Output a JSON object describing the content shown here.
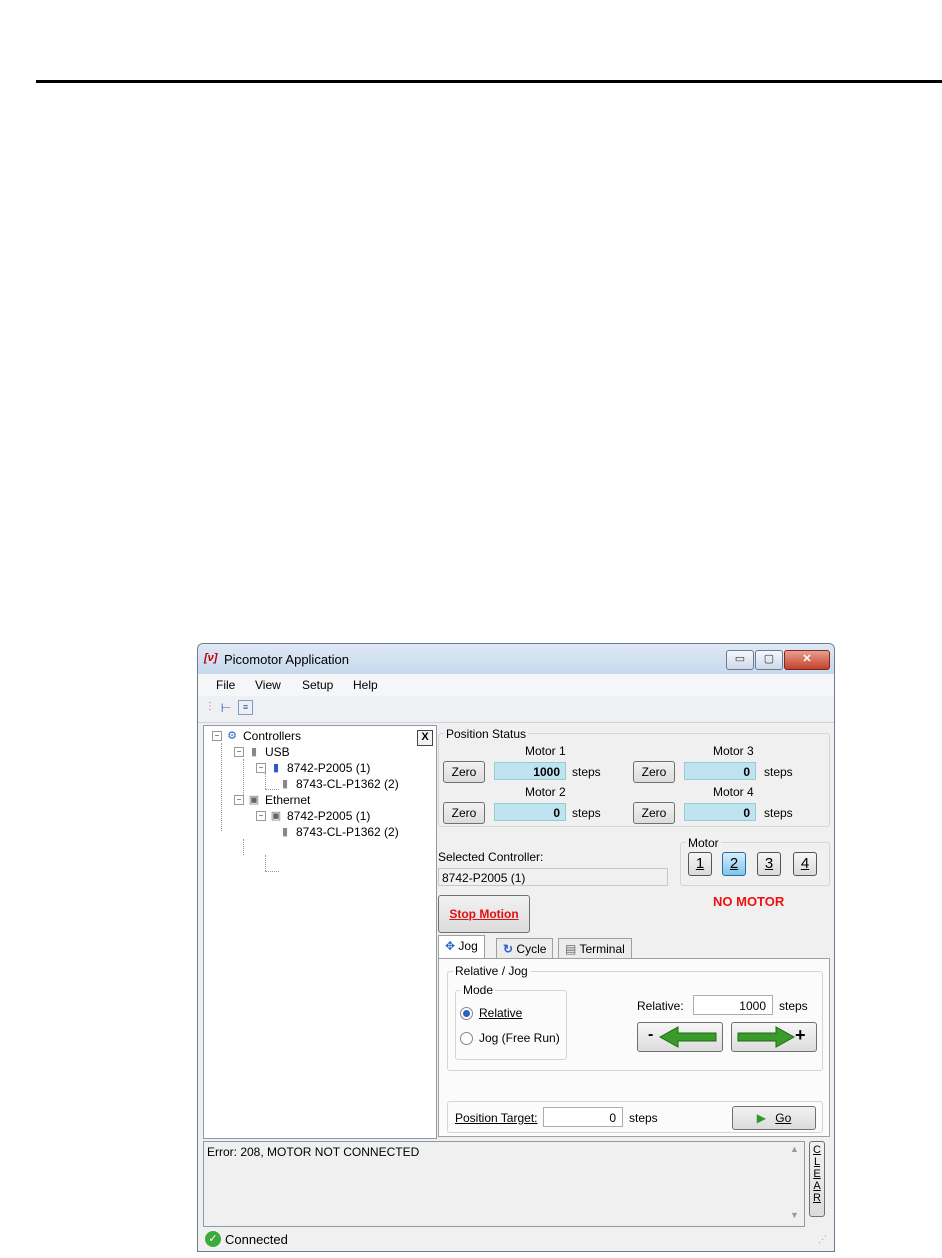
{
  "window": {
    "logo": "[ν]",
    "title": "Picomotor Application",
    "min": "▭",
    "max": "▢",
    "close": "✕"
  },
  "menu": [
    "File",
    "View",
    "Setup",
    "Help"
  ],
  "tree": {
    "close_label": "X",
    "nodes": [
      "Controllers",
      "USB",
      "8742-P2005 (1)",
      "8743-CL-P1362 (2)",
      "Ethernet",
      "8742-P2005 (1)",
      "8743-CL-P1362 (2)"
    ]
  },
  "position_status": {
    "title": "Position Status",
    "zero_label": "Zero",
    "units": "steps",
    "motors": [
      {
        "name": "Motor 1",
        "value": "1000"
      },
      {
        "name": "Motor 2",
        "value": "0"
      },
      {
        "name": "Motor 3",
        "value": "0"
      },
      {
        "name": "Motor 4",
        "value": "0"
      }
    ]
  },
  "selected_controller": {
    "label": "Selected Controller:",
    "value": "8742-P2005 (1)"
  },
  "motor_select": {
    "title": "Motor",
    "buttons": [
      "1",
      "2",
      "3",
      "4"
    ],
    "active": "2",
    "status": "NO MOTOR",
    "status_color": "#ee1111"
  },
  "stop_motion_label": "Stop Motion",
  "tabs": [
    "Jog",
    "Cycle",
    "Terminal"
  ],
  "jog": {
    "group_title": "Relative / Jog",
    "mode_title": "Mode",
    "mode_options": [
      "Relative",
      "Jog (Free Run)"
    ],
    "mode_selected": "Relative",
    "relative_label": "Relative:",
    "relative_value": "1000",
    "units": "steps",
    "minus": "-",
    "plus": "+",
    "position_target_label": "Position Target:",
    "position_target_value": "0",
    "go_label": "Go"
  },
  "log": {
    "text": "Error: 208, MOTOR NOT CONNECTED",
    "clear_label": "CLEAR"
  },
  "status": {
    "text": "Connected",
    "color": "#3cab3c"
  }
}
